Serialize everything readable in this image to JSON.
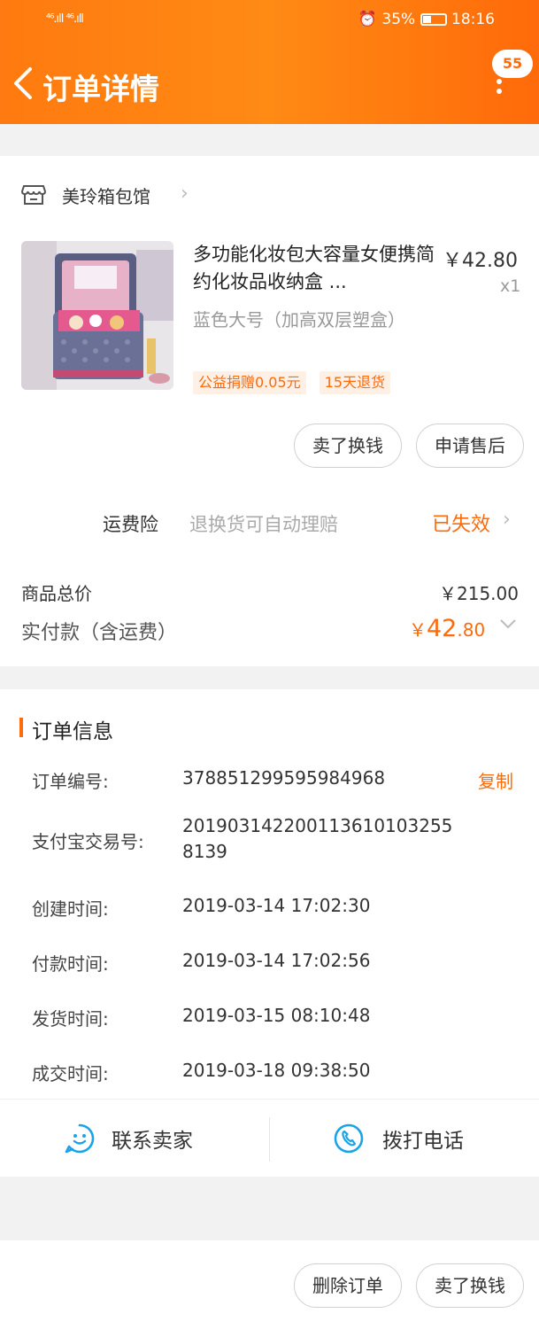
{
  "status_bar": {
    "signal": "⁴⁶.ıll ⁴⁶.ıll",
    "battery": "35%",
    "time": "18:16"
  },
  "nav": {
    "title": "订单详情",
    "badge": "55"
  },
  "shop": {
    "name": "美玲箱包馆"
  },
  "product": {
    "title": "多功能化妆包大容量女便携简约化妆品收纳盒 ...",
    "price": "￥42.80",
    "qty": "x1",
    "sku": "蓝色大号（加高双层塑盒）",
    "tags": [
      "公益捐赠0.05元",
      "15天退货"
    ]
  },
  "item_buttons": {
    "sell": "卖了换钱",
    "after_sale": "申请售后"
  },
  "insurance": {
    "label": "运费险",
    "desc": "退换货可自动理赔",
    "status": "已失效"
  },
  "totals": {
    "goods_label": "商品总价",
    "goods_value": "￥215.00",
    "paid_label": "实付款（含运费）",
    "paid_currency": "￥",
    "paid_int": "42",
    "paid_dec": ".80"
  },
  "order_info": {
    "title": "订单信息",
    "copy_label": "复制",
    "rows": [
      {
        "label": "订单编号:",
        "value": "378851299595984968"
      },
      {
        "label": "支付宝交易号:",
        "value": "2019031422001136101032558139"
      },
      {
        "label": "创建时间:",
        "value": "2019-03-14 17:02:30"
      },
      {
        "label": "付款时间:",
        "value": "2019-03-14 17:02:56"
      },
      {
        "label": "发货时间:",
        "value": "2019-03-15 08:10:48"
      },
      {
        "label": "成交时间:",
        "value": "2019-03-18 09:38:50"
      }
    ]
  },
  "contact": {
    "seller": "联系卖家",
    "phone": "拨打电话"
  },
  "bottom": {
    "delete": "删除订单",
    "sell": "卖了换钱"
  },
  "colors": {
    "accent": "#ff6a0a",
    "header_start": "#ff7a10",
    "icon_blue": "#1aa3e8"
  },
  "icons": [
    "back-icon",
    "more-icon",
    "shop-icon",
    "chevron-right-icon",
    "chevron-down-icon",
    "chat-face-icon",
    "phone-icon"
  ]
}
